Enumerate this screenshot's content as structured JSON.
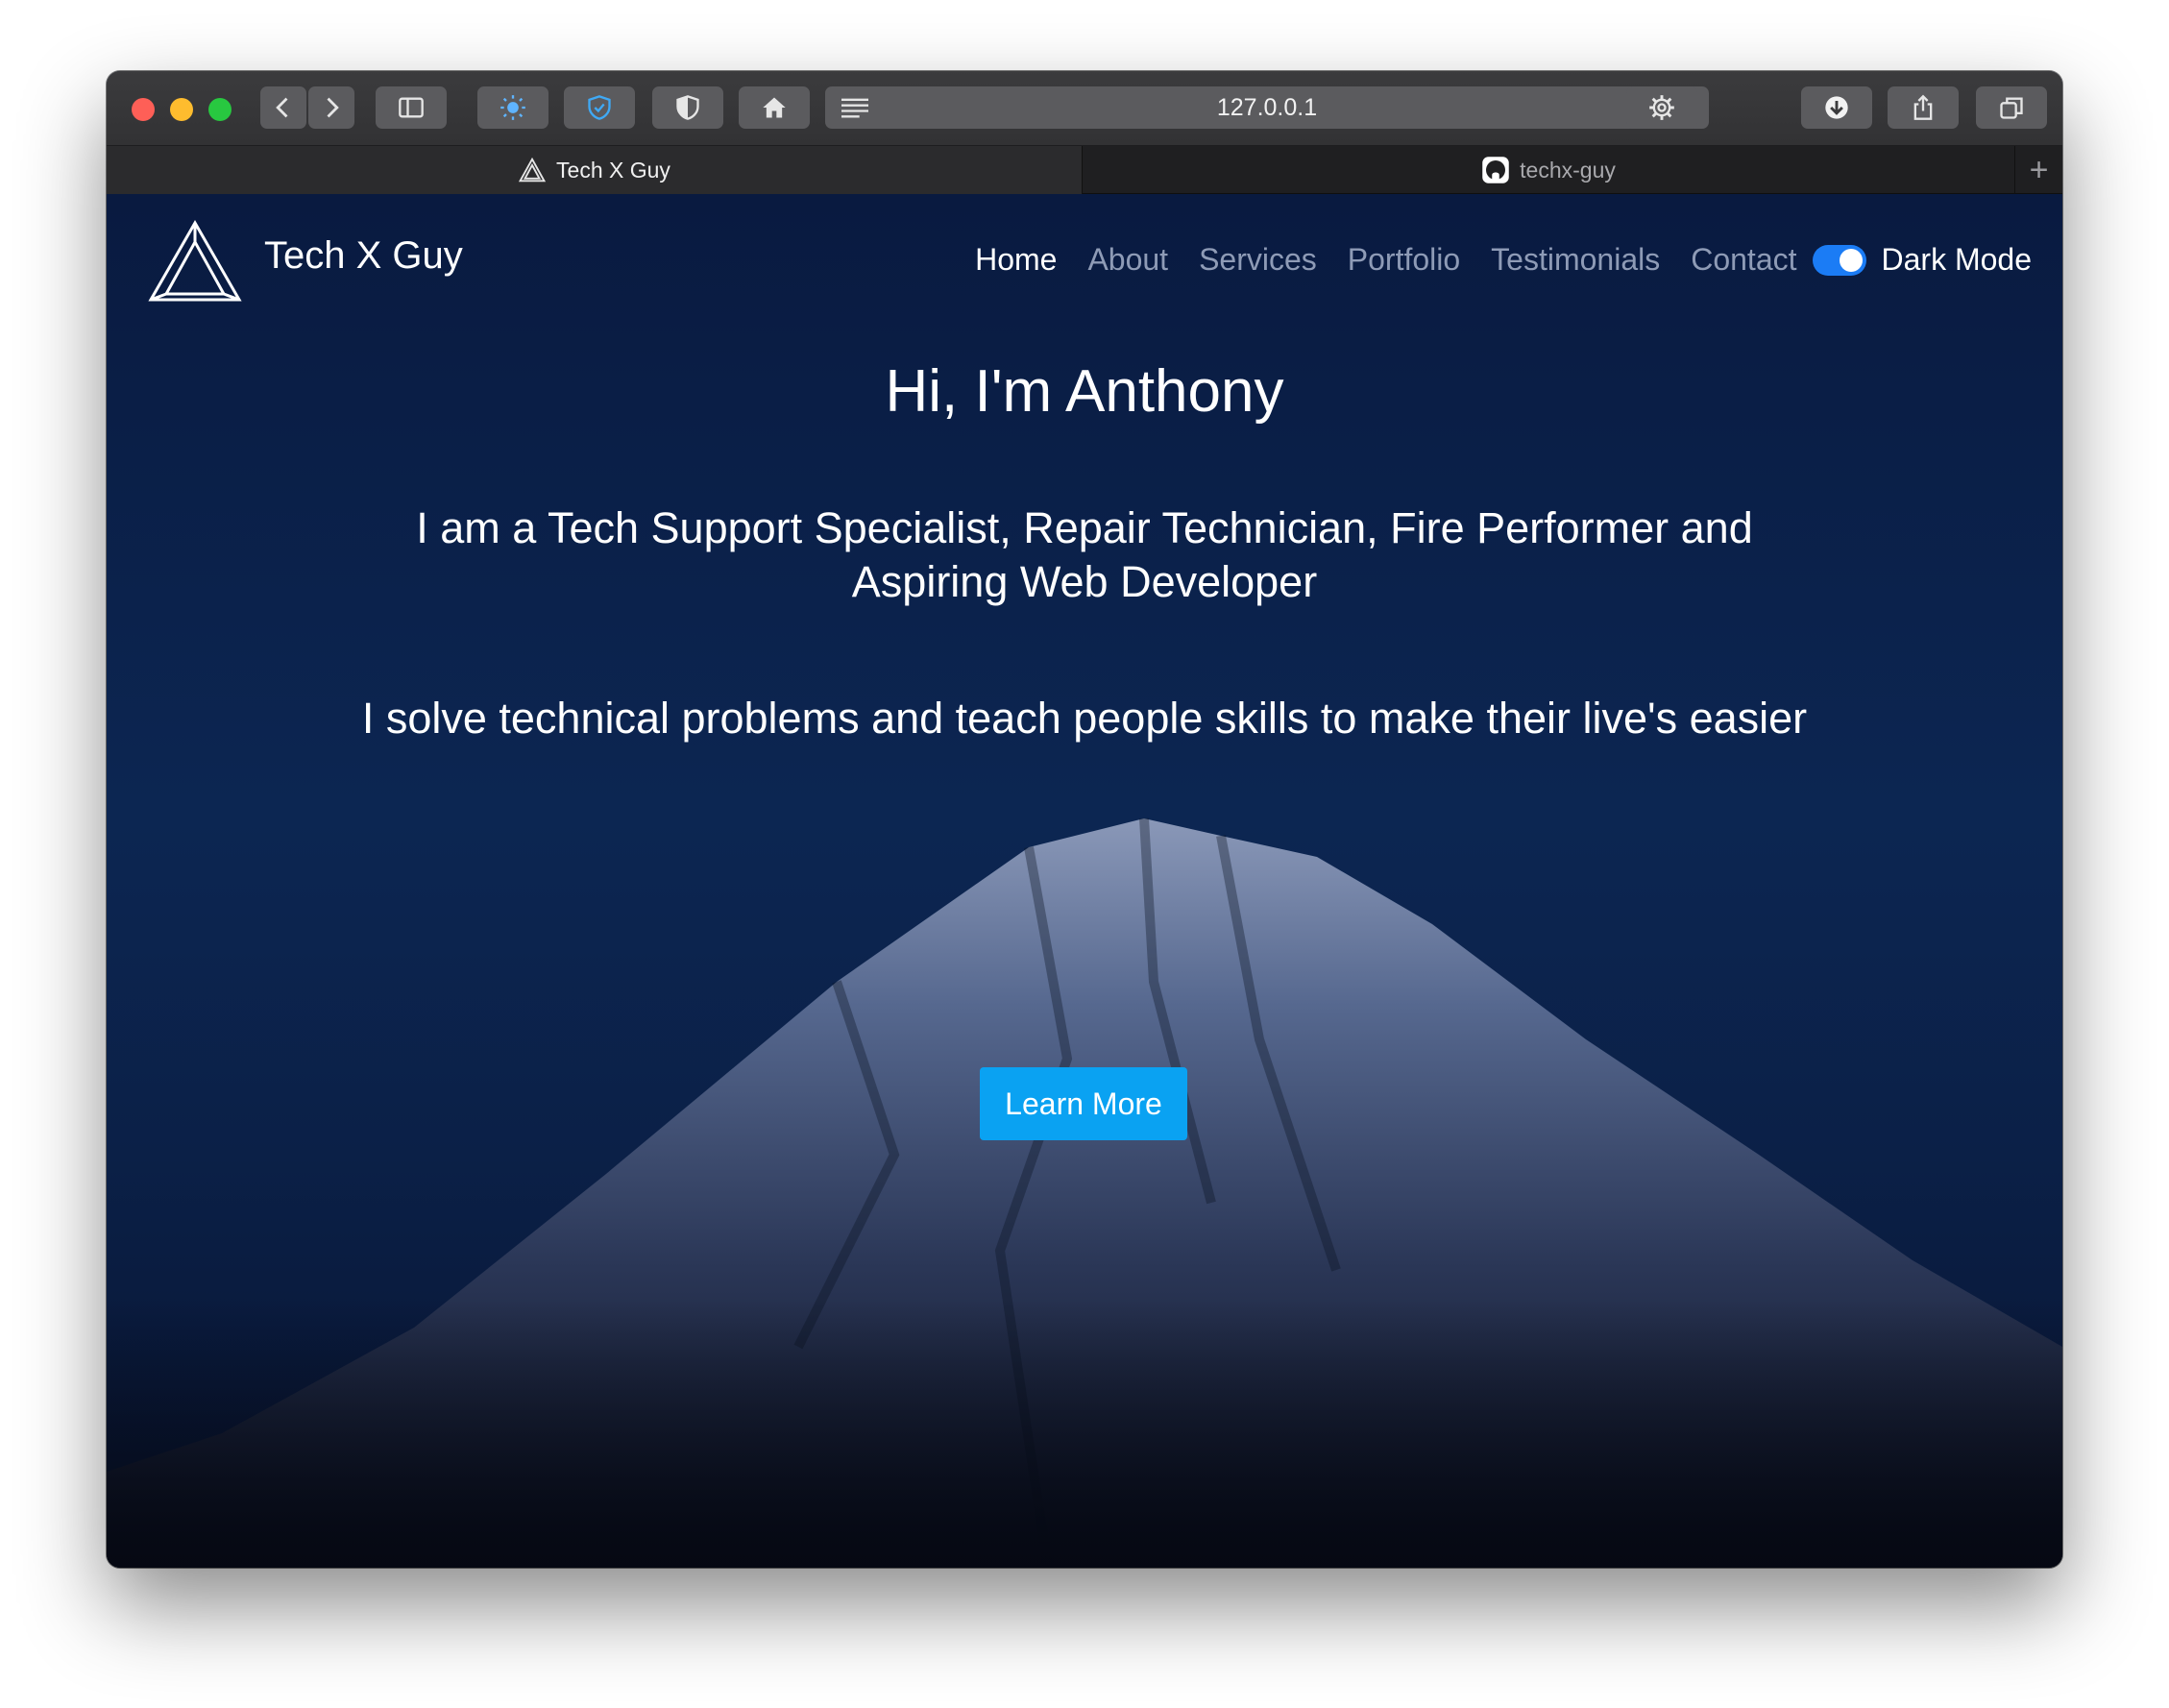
{
  "browser": {
    "url": "127.0.0.1",
    "tabs": [
      {
        "label": "Tech X Guy",
        "active": true,
        "icon": "triangle-logo-icon"
      },
      {
        "label": "techx-guy",
        "active": false,
        "icon": "github-icon"
      }
    ],
    "new_tab_label": "+"
  },
  "site": {
    "brand": "Tech X Guy",
    "nav": {
      "home": "Home",
      "about": "About",
      "services": "Services",
      "portfolio": "Portfolio",
      "testimonials": "Testimonials",
      "contact": "Contact",
      "dark_mode_label": "Dark Mode",
      "dark_mode_on": true
    },
    "hero": {
      "title": "Hi, I'm Anthony",
      "subtitle": "I am a Tech Support Specialist, Repair Technician, Fire Performer and Aspiring Web Developer",
      "tagline": "I solve technical problems and teach people skills to make their live's easier",
      "cta_label": "Learn More"
    }
  },
  "colors": {
    "accent": "#0aa2f2",
    "toggle": "#1b7cf5",
    "nav_inactive": "#8e9bb6",
    "background": "#0b2047"
  }
}
